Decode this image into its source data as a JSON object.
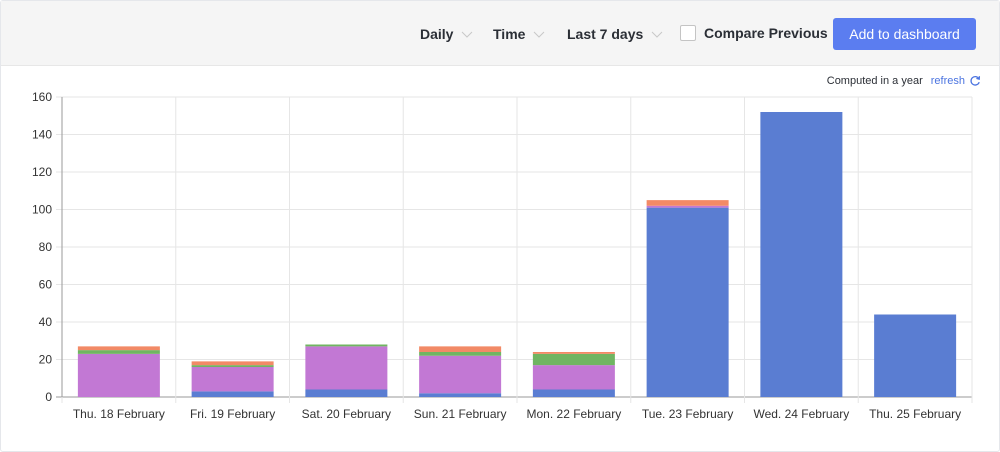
{
  "toolbar": {
    "interval": "Daily",
    "metric": "Time",
    "range": "Last 7 days",
    "compare_label": "Compare Previous",
    "add_label": "Add to dashboard"
  },
  "status": {
    "computed": "Computed in a year",
    "refresh": "refresh"
  },
  "colors": {
    "accent": "#5b7df0",
    "link": "#4b74e0",
    "series_blue": "#5a7dd2",
    "series_purple": "#c278d4",
    "series_green": "#70b562",
    "series_orange": "#f28a66"
  },
  "chart_data": {
    "type": "bar",
    "stacked": true,
    "categories": [
      "Thu. 18 February",
      "Fri. 19 February",
      "Sat. 20 February",
      "Sun. 21 February",
      "Mon. 22 February",
      "Tue. 23 February",
      "Wed. 24 February",
      "Thu. 25 February"
    ],
    "series": [
      {
        "color": "#5a7dd2",
        "values": [
          0,
          3,
          4,
          2,
          4,
          101,
          152,
          44
        ]
      },
      {
        "color": "#c278d4",
        "values": [
          23,
          13,
          23,
          20,
          13,
          1,
          0,
          0
        ]
      },
      {
        "color": "#70b562",
        "values": [
          2,
          1,
          1,
          2,
          6,
          0,
          0,
          0
        ]
      },
      {
        "color": "#f28a66",
        "values": [
          2,
          2,
          0,
          3,
          1,
          3,
          0,
          0
        ]
      }
    ],
    "ylim": [
      0,
      160
    ],
    "yticks": [
      0,
      20,
      40,
      60,
      80,
      100,
      120,
      140,
      160
    ],
    "grid": true
  }
}
